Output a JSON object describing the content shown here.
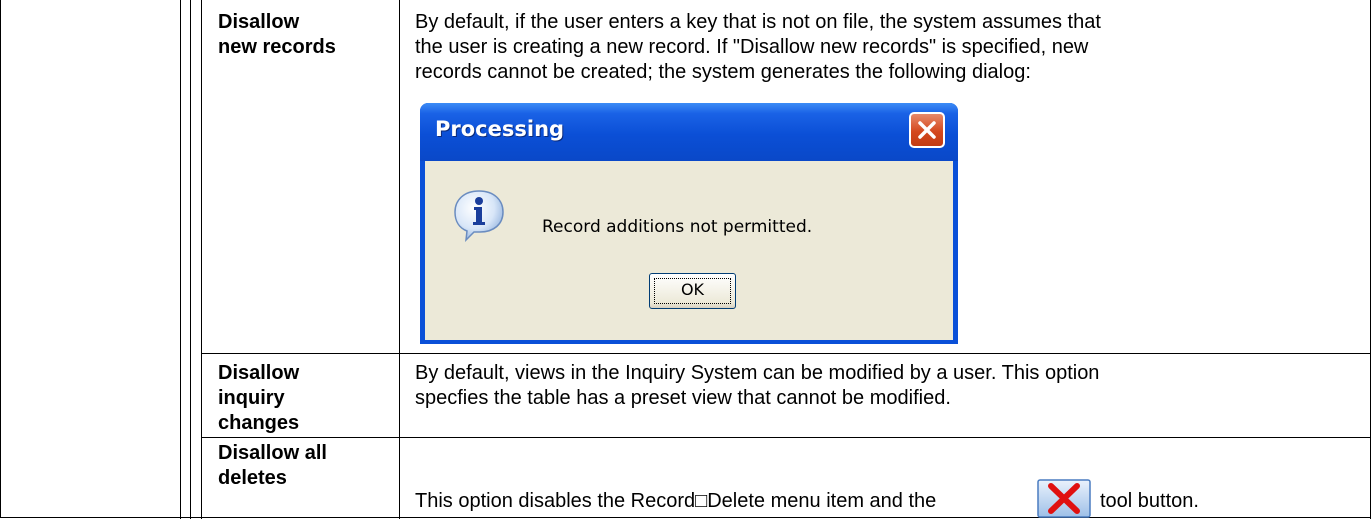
{
  "rows": [
    {
      "term": [
        "Disallow",
        "new records"
      ],
      "description": [
        "By default, if the user enters a key that is not on file, the system assumes that",
        "the user is creating a new record. If \"Disallow new records\" is specified, new",
        "records cannot be created; the system generates the following dialog:"
      ]
    },
    {
      "term": [
        "Disallow",
        "inquiry",
        "changes"
      ],
      "description": [
        "By default, views in the Inquiry System can be modified by a user. This option",
        "specfies the table has a preset view that cannot be modified."
      ]
    },
    {
      "term": [
        "Disallow all",
        "deletes"
      ],
      "description_before": "This option disables the Record□Delete menu item and the",
      "description_after": "tool button."
    }
  ],
  "dialog": {
    "title": "Processing",
    "message": "Record additions not permitted.",
    "ok_label": "OK",
    "icon": "info-icon"
  },
  "tool_button_icon": "delete-x-icon",
  "colors": {
    "title_bar": "#0b4fd6",
    "dialog_body": "#ece9d8",
    "close_button": "#d4481e",
    "delete_icon": "#e01010"
  }
}
